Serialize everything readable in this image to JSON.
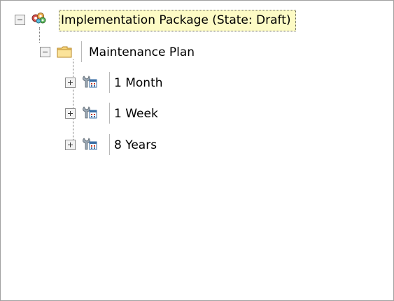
{
  "tree": {
    "root": {
      "label": "Implementation Package (State: Draft)",
      "icon": "package-gears-icon",
      "expanded": true,
      "selected": true
    },
    "folder": {
      "label": "Maintenance Plan",
      "icon": "folder-icon",
      "expanded": true
    },
    "items": [
      {
        "label": "1 Month",
        "icon": "wrench-calendar-icon",
        "expanded": false
      },
      {
        "label": "1 Week",
        "icon": "wrench-calendar-icon",
        "expanded": false
      },
      {
        "label": "8 Years",
        "icon": "wrench-calendar-icon",
        "expanded": false
      }
    ]
  },
  "colors": {
    "selection_background": "#fdfbc5",
    "panel_border": "#a0a0a0",
    "folder_fill": "#f7d57a"
  }
}
